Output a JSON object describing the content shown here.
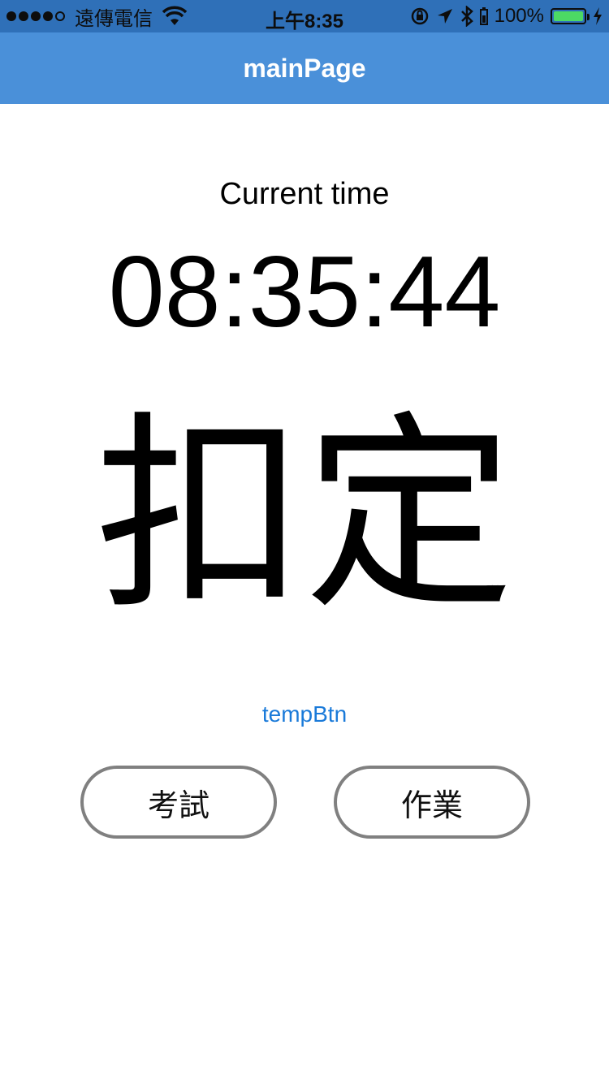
{
  "status_bar": {
    "carrier": "遠傳電信",
    "time": "上午8:35",
    "battery_percent": "100%",
    "battery_level": 1.0,
    "signal_bars_filled": 4,
    "signal_bars_total": 5,
    "icons": [
      "wifi-icon",
      "rotation-lock-icon",
      "location-arrow-icon",
      "bluetooth-icon",
      "battery-icon",
      "charging-bolt-icon"
    ]
  },
  "nav": {
    "title": "mainPage"
  },
  "main": {
    "time_label": "Current time",
    "clock": "08:35:44",
    "status_word": "扣定",
    "temp_button": "tempBtn",
    "exam_button": "考試",
    "homework_button": "作業"
  },
  "colors": {
    "status_bar_bg": "#2f70b8",
    "nav_bg": "#4a90d9",
    "link_blue": "#1a7ad9",
    "button_border": "#808080",
    "battery_green": "#4cd964"
  }
}
